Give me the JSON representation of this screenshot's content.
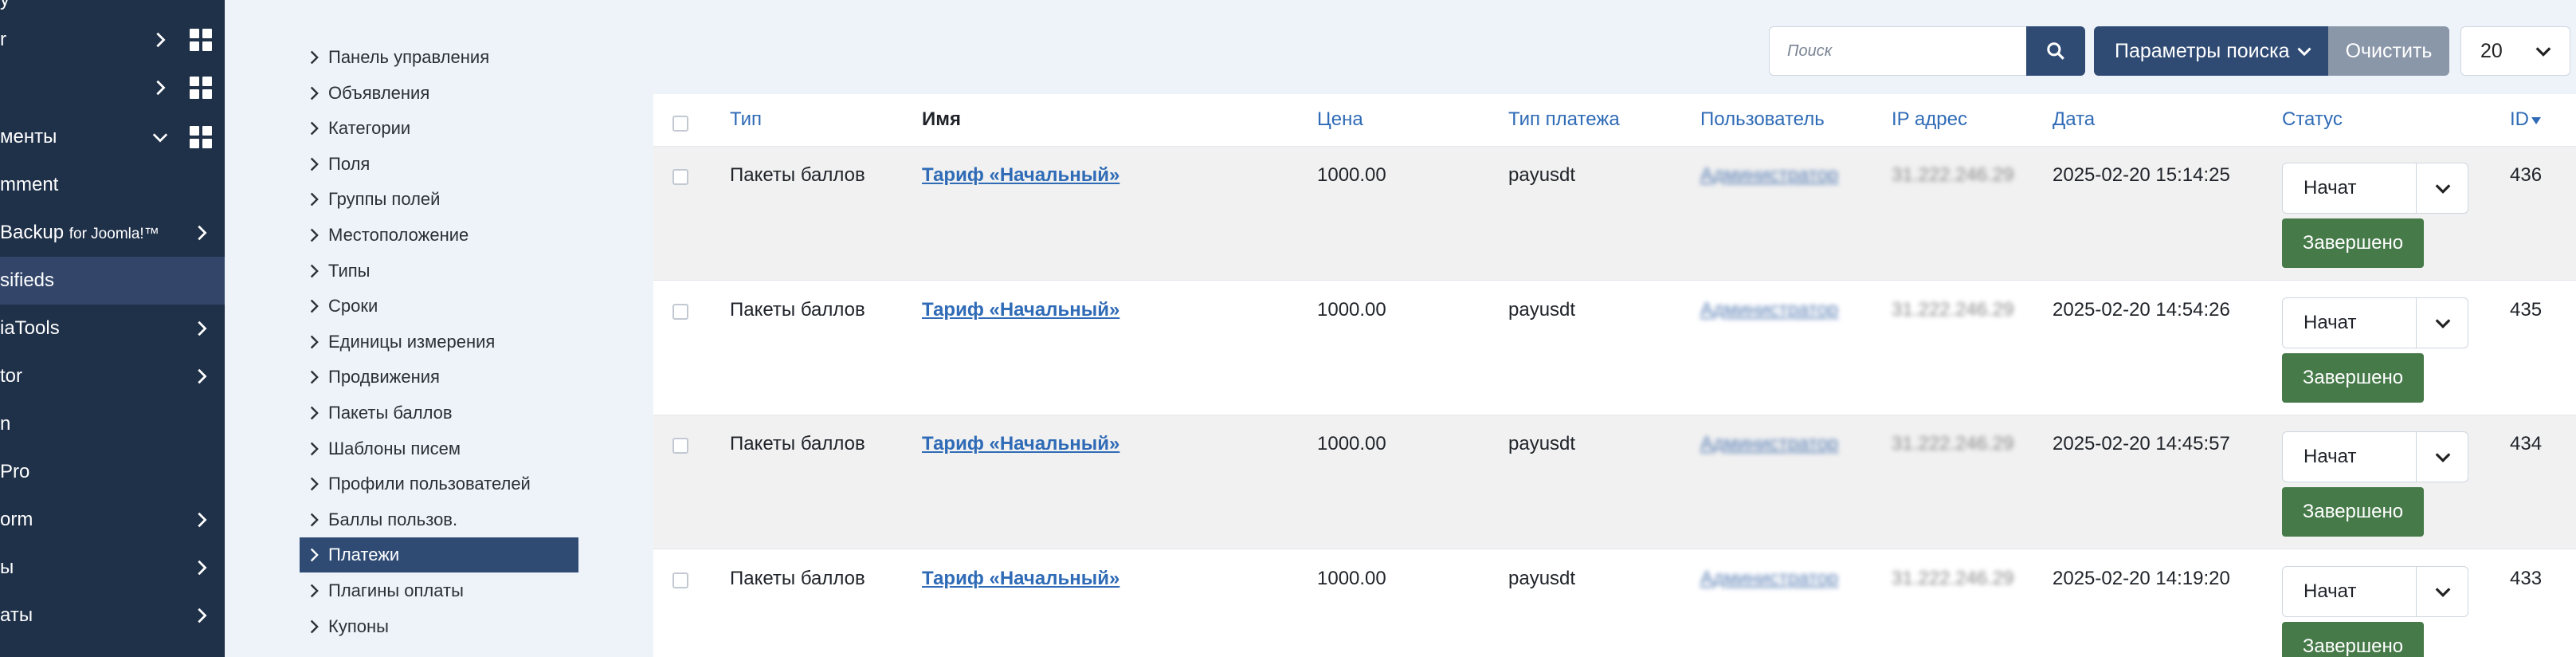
{
  "admin_sidebar": {
    "items": [
      {
        "label": "у",
        "chevron": false
      },
      {
        "label": "r",
        "chevron": true
      },
      {
        "label": "",
        "chevron": true
      },
      {
        "label": "менты",
        "chevron": true
      },
      {
        "label": "mment",
        "chevron": false
      },
      {
        "label": "Backup",
        "small": "for Joomla!™",
        "chevron": true
      },
      {
        "label": "sifieds",
        "chevron": false,
        "active": true
      },
      {
        "label": "iaTools",
        "chevron": true
      },
      {
        "label": "tor",
        "chevron": true
      },
      {
        "label": "n",
        "chevron": false
      },
      {
        "label": "Pro",
        "chevron": false
      },
      {
        "label": "orm",
        "chevron": true
      },
      {
        "label": "ы",
        "chevron": true
      },
      {
        "label": "аты",
        "chevron": true
      }
    ]
  },
  "submenu": {
    "items": [
      "Панель управления",
      "Объявления",
      "Категории",
      "Поля",
      "Группы полей",
      "Местоположение",
      "Типы",
      "Сроки",
      "Единицы измерения",
      "Продвижения",
      "Пакеты баллов",
      "Шаблоны писем",
      "Профили пользователей",
      "Баллы пользов.",
      "Платежи",
      "Плагины оплаты",
      "Купоны"
    ],
    "active_index": 14
  },
  "toolbar": {
    "search_placeholder": "Поиск",
    "params_label": "Параметры поиска",
    "clear_label": "Очистить",
    "limit_value": "20"
  },
  "table": {
    "headers": {
      "type": "Тип",
      "name": "Имя",
      "price": "Цена",
      "payment_type": "Тип платежа",
      "user": "Пользователь",
      "ip": "IP адрес",
      "date": "Дата",
      "status": "Статус",
      "id": "ID"
    },
    "rows": [
      {
        "type": "Пакеты баллов",
        "name": "Тариф «Начальный»",
        "price": "1000.00",
        "payment_type": "payusdt",
        "user": "Администратор",
        "ip": "31.222.246.29",
        "date": "2025-02-20 15:14:25",
        "status": "Начат",
        "action": "Завершено",
        "id": "436"
      },
      {
        "type": "Пакеты баллов",
        "name": "Тариф «Начальный»",
        "price": "1000.00",
        "payment_type": "payusdt",
        "user": "Администратор",
        "ip": "31.222.246.29",
        "date": "2025-02-20 14:54:26",
        "status": "Начат",
        "action": "Завершено",
        "id": "435"
      },
      {
        "type": "Пакеты баллов",
        "name": "Тариф «Начальный»",
        "price": "1000.00",
        "payment_type": "payusdt",
        "user": "Администратор",
        "ip": "31.222.246.29",
        "date": "2025-02-20 14:45:57",
        "status": "Начат",
        "action": "Завершено",
        "id": "434"
      },
      {
        "type": "Пакеты баллов",
        "name": "Тариф «Начальный»",
        "price": "1000.00",
        "payment_type": "payusdt",
        "user": "Администратор",
        "ip": "31.222.246.29",
        "date": "2025-02-20 14:19:20",
        "status": "Начат",
        "action": "Завершено",
        "id": "433"
      }
    ]
  },
  "colors": {
    "sidebar_bg": "#1f3049",
    "primary": "#2f4b74",
    "success": "#467a49",
    "link": "#2f6bb6"
  }
}
